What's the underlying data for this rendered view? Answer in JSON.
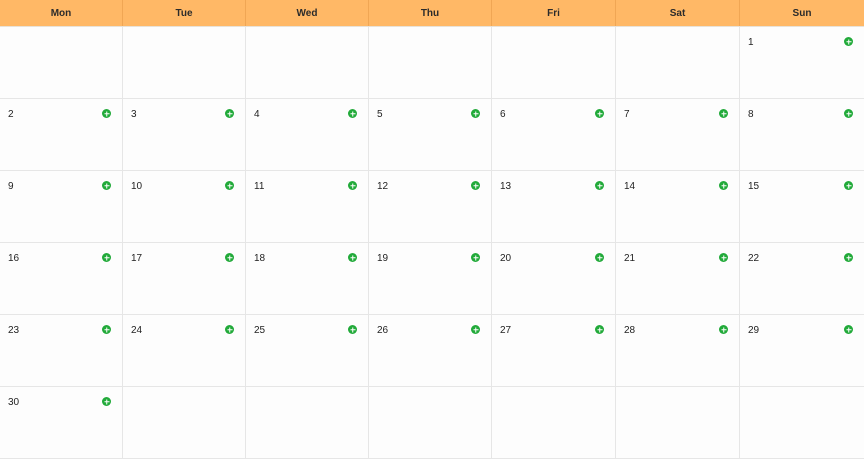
{
  "weekdays": [
    "Mon",
    "Tue",
    "Wed",
    "Thu",
    "Fri",
    "Sat",
    "Sun"
  ],
  "weeks": [
    [
      "",
      "",
      "",
      "",
      "",
      "",
      "1"
    ],
    [
      "2",
      "3",
      "4",
      "5",
      "6",
      "7",
      "8"
    ],
    [
      "9",
      "10",
      "11",
      "12",
      "13",
      "14",
      "15"
    ],
    [
      "16",
      "17",
      "18",
      "19",
      "20",
      "21",
      "22"
    ],
    [
      "23",
      "24",
      "25",
      "26",
      "27",
      "28",
      "29"
    ],
    [
      "30",
      "",
      "",
      "",
      "",
      "",
      ""
    ]
  ],
  "colors": {
    "header_bg": "#ffb866",
    "add_icon": "#22aa3a"
  },
  "icons": {
    "add": "plus-circle-icon"
  }
}
